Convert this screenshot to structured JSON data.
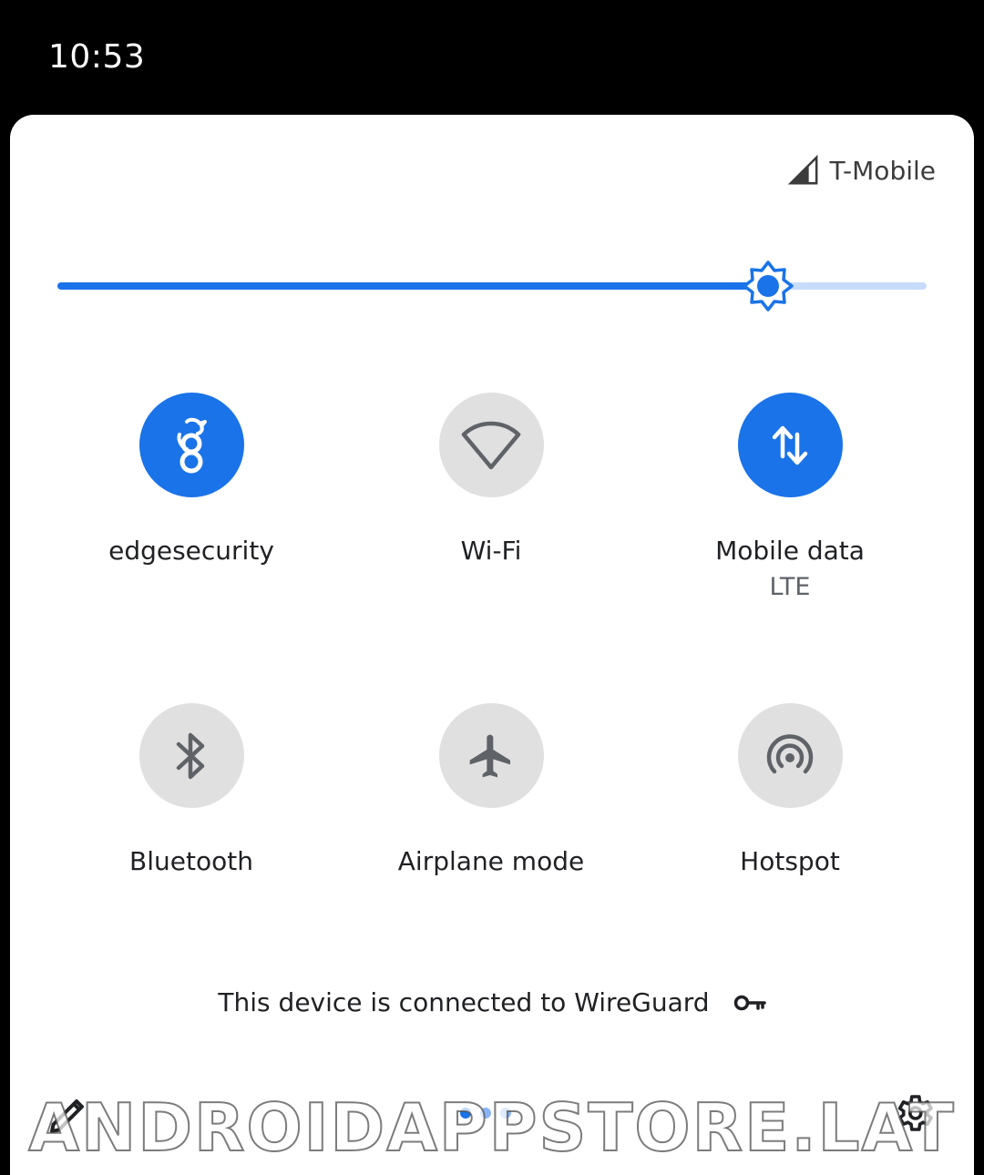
{
  "status_bar": {
    "time": "10:53"
  },
  "carrier": {
    "name": "T-Mobile",
    "icon": "cell-signal-icon"
  },
  "brightness": {
    "level": 0.818,
    "icon": "brightness-icon"
  },
  "tiles": [
    {
      "label": "edgesecurity",
      "sublabel": "",
      "icon": "wireguard-icon",
      "active": true
    },
    {
      "label": "Wi-Fi",
      "sublabel": "",
      "icon": "wifi-icon",
      "active": false
    },
    {
      "label": "Mobile data",
      "sublabel": "LTE",
      "icon": "mobile-data-icon",
      "active": true
    },
    {
      "label": "Bluetooth",
      "sublabel": "",
      "icon": "bluetooth-icon",
      "active": false
    },
    {
      "label": "Airplane mode",
      "sublabel": "",
      "icon": "airplane-icon",
      "active": false
    },
    {
      "label": "Hotspot",
      "sublabel": "",
      "icon": "hotspot-icon",
      "active": false
    }
  ],
  "vpn_footer": {
    "text": "This device is connected to WireGuard",
    "icon": "key-icon"
  },
  "bottom_bar": {
    "edit_icon": "pencil-icon",
    "settings_icon": "gear-icon",
    "pages": 3,
    "current_page": 1
  },
  "watermark": "ANDROIDAPPSTORE.LAT",
  "colors": {
    "accent": "#1a73e8",
    "accent_light": "#c7dcfb",
    "tile_off": "#e0e0e0",
    "icon_off": "#5f6368"
  }
}
